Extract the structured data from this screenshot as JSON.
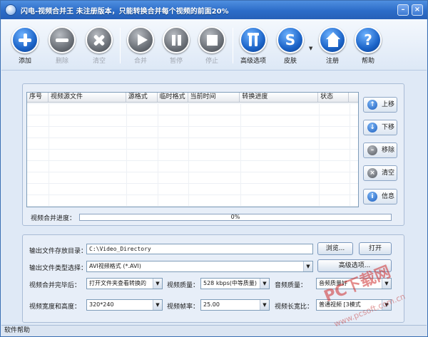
{
  "window": {
    "title": "闪电-视频合并王  未注册版本，只能转换合并每个视频的前面20%"
  },
  "toolbar": {
    "add": "添加",
    "delete": "删除",
    "clear": "清空",
    "merge": "合并",
    "pause": "暂停",
    "stop": "停止",
    "advanced": "高级选项",
    "skin": "皮肤",
    "register": "注册",
    "help": "帮助",
    "skin_glyph": "S",
    "help_glyph": "?"
  },
  "list": {
    "columns": [
      "序号",
      "视频源文件",
      "源格式",
      "临时格式",
      "当前时间",
      "转换进度",
      "状态"
    ]
  },
  "side": {
    "up": "上移",
    "down": "下移",
    "remove": "移除",
    "clear": "清空",
    "info": "信息"
  },
  "progress": {
    "label": "视频合并进度：",
    "text": "0%",
    "value": 0
  },
  "settings": {
    "output_dir_label": "输出文件存放目录：",
    "output_dir": "C:\\Video_Directory",
    "browse": "浏览...",
    "open": "打开",
    "type_label": "输出文件类型选择：",
    "type_value": "AVI视频格式 (*.AVI)",
    "advanced": "高级选项...",
    "after_label": "视频合并完毕后：",
    "after_value": "打开文件夹查看转换的",
    "quality_label": "视频质量：",
    "quality_value": "528 kbps(中等质量)",
    "audio_label": "音频质量：",
    "audio_value": "音频质量好",
    "size_label": "视频宽度和高度：",
    "size_value": "320*240",
    "fps_label": "视频帧率：",
    "fps_value": "25.00",
    "aspect_label": "视频长宽比：",
    "aspect_value": "普通视频  [3模式"
  },
  "status": {
    "text": "软件帮助"
  },
  "watermark": {
    "main": "PC下载网",
    "sub": "www.pcsoft.com.cn"
  }
}
